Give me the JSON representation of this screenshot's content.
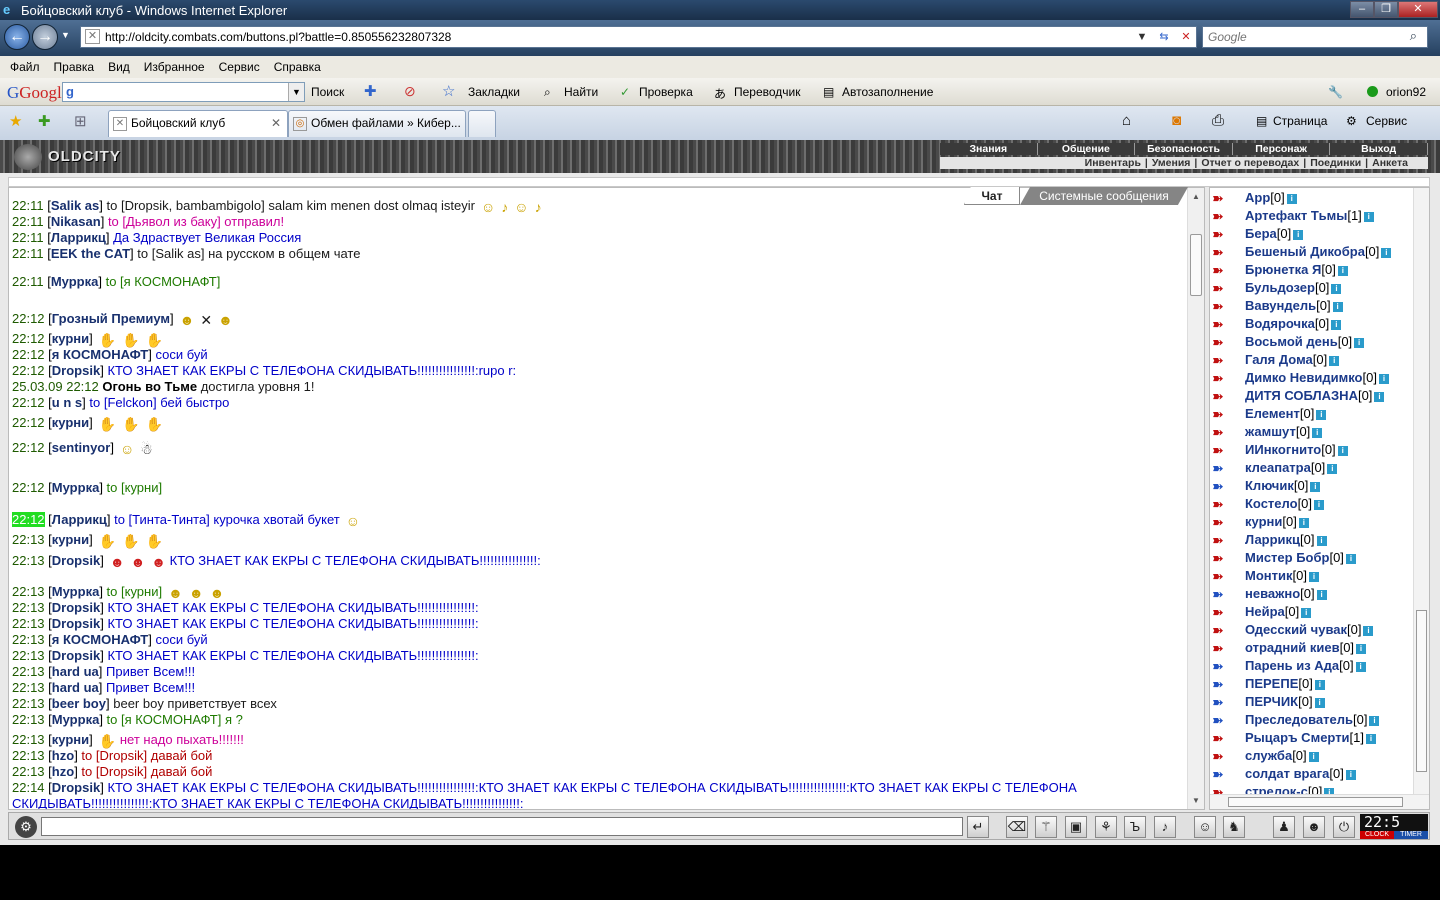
{
  "window": {
    "title": "Бойцовский клуб - Windows Internet Explorer",
    "url": "http://oldcity.combats.com/buttons.pl?battle=0.850556232807328",
    "search_placeholder": "Google"
  },
  "menubar": [
    "Файл",
    "Правка",
    "Вид",
    "Избранное",
    "Сервис",
    "Справка"
  ],
  "google_toolbar": {
    "logo": "Google",
    "search_btn": "Поиск",
    "bookmarks": "Закладки",
    "find": "Найти",
    "check": "Проверка",
    "translate": "Переводчик",
    "autofill": "Автозаполнение",
    "user": "orion92"
  },
  "tabs": [
    {
      "label": "Бойцовский клуб",
      "active": true
    },
    {
      "label": "Обмен файлами » Кибер..."
    }
  ],
  "tab_tools": {
    "page": "Страница",
    "service": "Сервис"
  },
  "game": {
    "logo": "OLDCITY",
    "menu_top": [
      "Знания",
      "Общение",
      "Безопасность",
      "Персонаж",
      "Выход"
    ],
    "menu_bottom": [
      "Инвентарь",
      "Умения",
      "Отчет о переводах",
      "Поединки",
      "Анкета"
    ],
    "chat_tabs": {
      "chat": "Чат",
      "system": "Системные сообщения"
    }
  },
  "chat": [
    {
      "time": "22:11",
      "name": "Salik as",
      "pre": " to [Dropsik, bambambigolo] ",
      "text": "salam kim menen dost olmaq isteyir",
      "cls": "dk",
      "sm": [
        {
          "c": "y",
          "g": "☺"
        },
        {
          "c": "y",
          "g": "♪"
        },
        {
          "c": "y",
          "g": "☺"
        },
        {
          "c": "y",
          "g": "♪"
        }
      ]
    },
    {
      "time": "22:11",
      "name": "Nikasan",
      "pre": " to [Дьявол из баку] ",
      "text": "отправил!",
      "cls": "mag",
      "precls": "mag"
    },
    {
      "time": "22:11",
      "name": "Ларрикц",
      "pre": " ",
      "text": "Да Здраствует Великая Россия",
      "cls": "blue"
    },
    {
      "time": "22:11",
      "name": "EEK the CAT",
      "pre": " to [Salik as] ",
      "text": "на русском в общем чате",
      "cls": "dk"
    },
    {
      "time": "22:11",
      "name": "Муррка",
      "pre": " to [я КОСМОНАФТ]",
      "text": "",
      "cls": "grn",
      "precls": "grn"
    },
    {
      "time": "22:12",
      "name": "Грозный Премиум",
      "pre": "",
      "text": "",
      "cls": "dk",
      "sm": [
        {
          "c": "y",
          "g": "☻"
        },
        {
          "c": "dk",
          "g": "✕"
        },
        {
          "c": "y",
          "g": "☻"
        }
      ]
    },
    {
      "time": "22:12",
      "name": "курни",
      "pre": "",
      "text": "",
      "cls": "dk",
      "sm": [
        {
          "c": "b",
          "g": "✋"
        },
        {
          "c": "b",
          "g": "✋"
        },
        {
          "c": "b",
          "g": "✋"
        }
      ]
    },
    {
      "time": "22:12",
      "name": "я КОСМОНАФТ",
      "pre": " ",
      "text": "соси буй",
      "cls": "blue"
    },
    {
      "time": "22:12",
      "name": "Dropsik",
      "pre": " ",
      "text": "КТО ЗНАЕТ КАК ЕКРЫ С ТЕЛЕФОНА СКИДЫВАТЬ!!!!!!!!!!!!!!!!:rupo r:",
      "cls": "blue"
    },
    {
      "time": "25.03.09 22:12",
      "name": "",
      "sys": "Огонь во Тьме",
      "text": " достигла уровня 1!",
      "cls": "dk"
    },
    {
      "time": "22:12",
      "name": "u n s",
      "pre": " to [Felckon] ",
      "text": "бей быстро",
      "cls": "blue",
      "precls": "blue"
    },
    {
      "time": "22:12",
      "name": "курни",
      "pre": "",
      "text": "",
      "cls": "dk",
      "sm": [
        {
          "c": "b",
          "g": "✋"
        },
        {
          "c": "b",
          "g": "✋"
        },
        {
          "c": "b",
          "g": "✋"
        }
      ]
    },
    {
      "time": "22:12",
      "name": "sentinyor",
      "pre": "",
      "text": "",
      "cls": "dk",
      "sm": [
        {
          "c": "y",
          "g": "☺"
        },
        {
          "c": "dk",
          "g": "☃"
        }
      ]
    },
    {
      "time": "22:12",
      "name": "Муррка",
      "pre": " to [курни]",
      "text": "",
      "cls": "grn",
      "precls": "grn"
    },
    {
      "time": "22:12",
      "name": "Ларрикц",
      "pre": " to [Тинта-Тинта] ",
      "text": "курочка хвотай букет",
      "cls": "blue",
      "precls": "blue",
      "hl": true,
      "sm": [
        {
          "c": "y",
          "g": "☺"
        }
      ]
    },
    {
      "time": "22:13",
      "name": "курни",
      "pre": "",
      "text": "",
      "cls": "dk",
      "sm": [
        {
          "c": "b",
          "g": "✋"
        },
        {
          "c": "b",
          "g": "✋"
        },
        {
          "c": "b",
          "g": "✋"
        }
      ]
    },
    {
      "time": "22:13",
      "name": "Dropsik",
      "pre": " ",
      "text": "КТО ЗНАЕТ КАК ЕКРЫ С ТЕЛЕФОНА СКИДЫВАТЬ!!!!!!!!!!!!!!!!:",
      "cls": "blue",
      "smfirst": [
        {
          "c": "r",
          "g": "☻"
        },
        {
          "c": "r",
          "g": "☻"
        },
        {
          "c": "r",
          "g": "☻"
        }
      ]
    },
    {
      "time": "22:13",
      "name": "Муррка",
      "pre": " to [курни]",
      "text": "",
      "cls": "grn",
      "precls": "grn",
      "sm": [
        {
          "c": "y",
          "g": "☻"
        },
        {
          "c": "y",
          "g": "☻"
        },
        {
          "c": "y",
          "g": "☻"
        }
      ]
    },
    {
      "time": "22:13",
      "name": "Dropsik",
      "pre": " ",
      "text": "КТО ЗНАЕТ КАК ЕКРЫ С ТЕЛЕФОНА СКИДЫВАТЬ!!!!!!!!!!!!!!!!:",
      "cls": "blue"
    },
    {
      "time": "22:13",
      "name": "Dropsik",
      "pre": " ",
      "text": "КТО ЗНАЕТ КАК ЕКРЫ С ТЕЛЕФОНА СКИДЫВАТЬ!!!!!!!!!!!!!!!!:",
      "cls": "blue"
    },
    {
      "time": "22:13",
      "name": "я КОСМОНАФТ",
      "pre": " ",
      "text": "соси буй",
      "cls": "blue"
    },
    {
      "time": "22:13",
      "name": "Dropsik",
      "pre": " ",
      "text": "КТО ЗНАЕТ КАК ЕКРЫ С ТЕЛЕФОНА СКИДЫВАТЬ!!!!!!!!!!!!!!!!:",
      "cls": "blue"
    },
    {
      "time": "22:13",
      "name": "hard ua",
      "pre": " ",
      "text": "Привет Всем!!!",
      "cls": "blue"
    },
    {
      "time": "22:13",
      "name": "hard ua",
      "pre": " ",
      "text": "Привет Всем!!!",
      "cls": "blue"
    },
    {
      "time": "22:13",
      "name": "beer boy",
      "pre": " ",
      "text": "beer boy приветствует всех",
      "cls": "dk"
    },
    {
      "time": "22:13",
      "name": "Муррка",
      "pre": " to [я КОСМОНАФТ] ",
      "text": "я ?",
      "cls": "grn",
      "precls": "grn"
    },
    {
      "time": "22:13",
      "name": "курни",
      "pre": " ",
      "text": "нет надо пыхать!!!!!!!",
      "cls": "mag",
      "sm0": [
        {
          "c": "b",
          "g": "✋"
        }
      ]
    },
    {
      "time": "22:13",
      "name": "hzo",
      "pre": " to [Dropsik] ",
      "text": "давай бой",
      "cls": "r2",
      "precls": "r2"
    },
    {
      "time": "22:13",
      "name": "hzo",
      "pre": " to [Dropsik] ",
      "text": "давай бой",
      "cls": "r2",
      "precls": "r2"
    },
    {
      "time": "22:14",
      "name": "Dropsik",
      "pre": " ",
      "text": "КТО ЗНАЕТ КАК ЕКРЫ С ТЕЛЕФОНА СКИДЫВАТЬ!!!!!!!!!!!!!!!!:КТО ЗНАЕТ КАК ЕКРЫ С ТЕЛЕФОНА СКИДЫВАТЬ!!!!!!!!!!!!!!!!:КТО ЗНАЕТ КАК ЕКРЫ С ТЕЛЕФОНА СКИДЫВАТЬ!!!!!!!!!!!!!!!!:КТО ЗНАЕТ КАК ЕКРЫ С ТЕЛЕФОНА СКИДЫВАТЬ!!!!!!!!!!!!!!!!:",
      "cls": "blue",
      "wrap": true
    }
  ],
  "users": [
    {
      "name": "App",
      "lvl": "[0]"
    },
    {
      "name": "Артефакт Тьмы",
      "lvl": "[1]"
    },
    {
      "name": "Бера",
      "lvl": "[0]"
    },
    {
      "name": "Бешеный Дикобра",
      "lvl": "[0]"
    },
    {
      "name": "Брюнетка Я",
      "lvl": "[0]"
    },
    {
      "name": "Бульдозер",
      "lvl": "[0]"
    },
    {
      "name": "Вавундель",
      "lvl": "[0]"
    },
    {
      "name": "Водярочка",
      "lvl": "[0]"
    },
    {
      "name": "Восьмой день",
      "lvl": "[0]"
    },
    {
      "name": "Галя Дома",
      "lvl": "[0]"
    },
    {
      "name": "Димко Невидимко",
      "lvl": "[0]"
    },
    {
      "name": "ДИТЯ СОБЛАЗНА",
      "lvl": "[0]"
    },
    {
      "name": "Елемент",
      "lvl": "[0]"
    },
    {
      "name": "жамшут",
      "lvl": "[0]"
    },
    {
      "name": "ИИнкогнито",
      "lvl": "[0]"
    },
    {
      "name": "клеапатра",
      "lvl": "[0]",
      "blue": true
    },
    {
      "name": "Ключик",
      "lvl": "[0]",
      "blue": true
    },
    {
      "name": "Костело",
      "lvl": "[0]"
    },
    {
      "name": "курни",
      "lvl": "[0]"
    },
    {
      "name": "Ларрикц",
      "lvl": "[0]"
    },
    {
      "name": "Мистер Бобр",
      "lvl": "[0]"
    },
    {
      "name": "Монтик",
      "lvl": "[0]"
    },
    {
      "name": "неважно",
      "lvl": "[0]",
      "blue": true
    },
    {
      "name": "Нейра",
      "lvl": "[0]"
    },
    {
      "name": "Одесский чувак",
      "lvl": "[0]"
    },
    {
      "name": "отрадний киев",
      "lvl": "[0]"
    },
    {
      "name": "Парень из Ада",
      "lvl": "[0]",
      "blue": true
    },
    {
      "name": "ПЕРЕПЕ",
      "lvl": "[0]",
      "blue": true
    },
    {
      "name": "ПЕРЧИК",
      "lvl": "[0]",
      "blue": true
    },
    {
      "name": "Преследователь",
      "lvl": "[0]",
      "blue": true
    },
    {
      "name": "Рыцаръ Смерти",
      "lvl": "[1]"
    },
    {
      "name": "служба",
      "lvl": "[0]"
    },
    {
      "name": "солдат врага",
      "lvl": "[0]",
      "blue": true
    },
    {
      "name": "стрелок-с",
      "lvl": "[0]"
    }
  ],
  "clock": {
    "time": "22:5",
    "label1": "CLOCK",
    "label2": "TIMER"
  }
}
